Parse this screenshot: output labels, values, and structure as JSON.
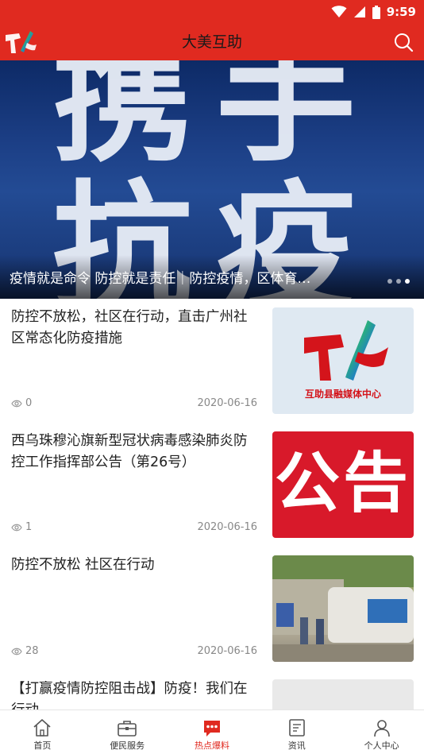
{
  "status": {
    "time": "9:59"
  },
  "header": {
    "title": "大美互助"
  },
  "banner": {
    "glyph_top": "携手",
    "glyph_bottom": "抗疫",
    "caption": "疫情就是命令 防控就是责任｜防控疫情，区体育…"
  },
  "news": [
    {
      "title": "防控不放松，社区在行动，直击广州社区常态化防疫措施",
      "views": "0",
      "date": "2020-06-16",
      "thumb_caption": "互助县融媒体中心"
    },
    {
      "title": "西乌珠穆沁旗新型冠状病毒感染肺炎防控工作指挥部公告（第26号）",
      "views": "1",
      "date": "2020-06-16",
      "thumb_text": "公告"
    },
    {
      "title": "防控不放松 社区在行动",
      "views": "28",
      "date": "2020-06-16"
    },
    {
      "title": "【打赢疫情防控阻击战】防疫！我们在行动"
    }
  ],
  "tabs": [
    {
      "label": "首页",
      "icon": "home-icon"
    },
    {
      "label": "便民服务",
      "icon": "briefcase-icon"
    },
    {
      "label": "热点爆料",
      "icon": "chat-icon",
      "active": true
    },
    {
      "label": "资讯",
      "icon": "news-icon"
    },
    {
      "label": "个人中心",
      "icon": "user-icon"
    }
  ],
  "colors": {
    "brand": "#e02a20",
    "meta": "#888888"
  }
}
